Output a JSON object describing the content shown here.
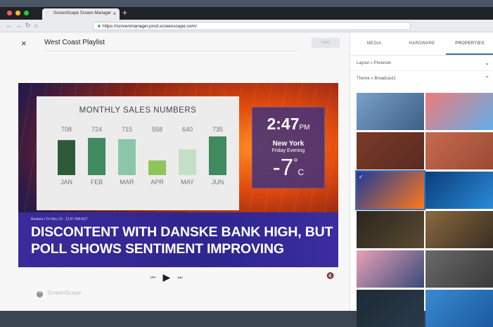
{
  "browser": {
    "tab_title": "ScreenScape Screen Manager",
    "url": "https://screenmanager.prod.screenscape.com/"
  },
  "editor": {
    "playlist_name": "West Coast Playlist",
    "save_label": "SAVE"
  },
  "right_panel": {
    "tabs": [
      {
        "label": "MEDIA"
      },
      {
        "label": "HARDWARE"
      },
      {
        "label": "PROPERTIES",
        "active": true
      }
    ],
    "layout_label": "Layout » Pioveson",
    "theme_label": "Theme » Broadcast1",
    "thumbnails": [
      {
        "name": "blue-gradient",
        "colors": [
          "#7aa0c8",
          "#3d5f88"
        ]
      },
      {
        "name": "sky-gradient",
        "colors": [
          "#f07a7a",
          "#5fb0e8"
        ]
      },
      {
        "name": "brick-dark",
        "colors": [
          "#7b3a2a",
          "#5a2a20"
        ]
      },
      {
        "name": "brick-light",
        "colors": [
          "#c76a4e",
          "#9a4a35"
        ]
      },
      {
        "name": "broadcast-orange-blue",
        "colors": [
          "#1d3c9a",
          "#ff7a1a"
        ],
        "selected": true
      },
      {
        "name": "studio-blue",
        "colors": [
          "#0b3d7a",
          "#2a8ad8"
        ]
      },
      {
        "name": "bokeh-dark",
        "colors": [
          "#2b2620",
          "#5a4a30"
        ]
      },
      {
        "name": "bokeh-gold",
        "colors": [
          "#8a6a40",
          "#3a2e22"
        ]
      },
      {
        "name": "dusk-city",
        "colors": [
          "#e7a0b8",
          "#3a4a78"
        ]
      },
      {
        "name": "grey-texture",
        "colors": [
          "#6a6a6a",
          "#3a3a3a"
        ]
      },
      {
        "name": "dark-panel",
        "colors": [
          "#1d2a36",
          "#2a3a4a"
        ]
      },
      {
        "name": "ocean",
        "colors": [
          "#3a8ad0",
          "#1a5aa0"
        ]
      }
    ]
  },
  "preview": {
    "sales_title": "MONTHLY SALES NUMBERS",
    "weather": {
      "time": "2:47",
      "ampm": "PM",
      "city": "New York",
      "period": "Friday Evening",
      "temp": "-7",
      "degree": "°",
      "unit": "C"
    },
    "ticker": {
      "meta": "Reuters / Fri Nov 23 · 11:57 AM AST",
      "line1": "DISCONTENT WITH DANSKE BANK HIGH, BUT",
      "line2": "POLL SHOWS SENTIMENT IMPROVING"
    }
  },
  "player": {
    "prev_icon": "skip-back-icon",
    "play_icon": "play-icon",
    "next_icon": "skip-forward-icon",
    "mute_icon": "mute-icon"
  },
  "footer": {
    "help_symbol": "?",
    "brand": "ScreenScape"
  },
  "chart_data": {
    "type": "bar",
    "title": "MONTHLY SALES NUMBERS",
    "categories": [
      "JAN",
      "FEB",
      "MAR",
      "APR",
      "MAY",
      "JUN"
    ],
    "values": [
      708,
      724,
      715,
      558,
      640,
      735
    ],
    "colors": [
      "#2e5a3a",
      "#3f8a5e",
      "#8cc6a8",
      "#8fc65a",
      "#c4e0c8",
      "#3f8a5e"
    ],
    "ylim": [
      0,
      800
    ]
  }
}
